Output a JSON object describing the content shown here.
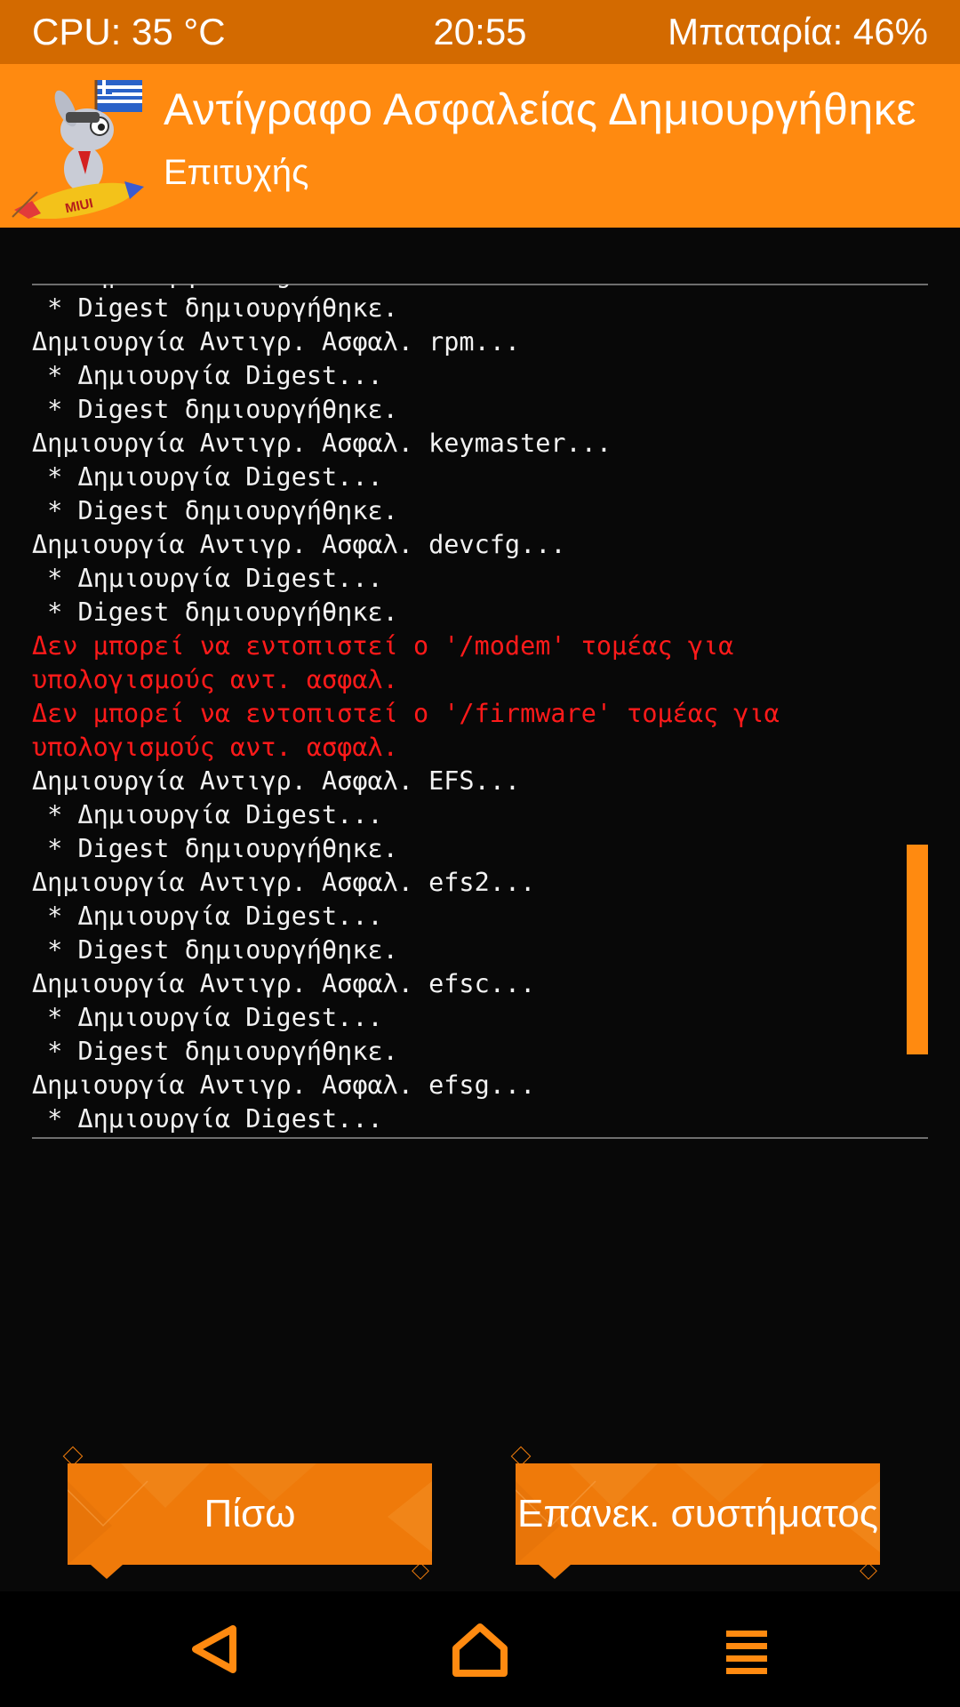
{
  "status_bar": {
    "cpu": "CPU: 35 °C",
    "time": "20:55",
    "battery": "Μπαταρία: 46%"
  },
  "header": {
    "title": "Αντίγραφο Ασφαλείας Δημιουργήθηκε",
    "subtitle": "Επιτυχής",
    "logo_text": "MIUI"
  },
  "console": {
    "lines": [
      {
        "text": " * Δημιουργία Digest...",
        "type": "normal"
      },
      {
        "text": " * Digest δημιουργήθηκε.",
        "type": "normal"
      },
      {
        "text": "Δημιουργία Αντιγρ. Ασφαλ. rpm...",
        "type": "normal"
      },
      {
        "text": " * Δημιουργία Digest...",
        "type": "normal"
      },
      {
        "text": " * Digest δημιουργήθηκε.",
        "type": "normal"
      },
      {
        "text": "Δημιουργία Αντιγρ. Ασφαλ. keymaster...",
        "type": "normal"
      },
      {
        "text": " * Δημιουργία Digest...",
        "type": "normal"
      },
      {
        "text": " * Digest δημιουργήθηκε.",
        "type": "normal"
      },
      {
        "text": "Δημιουργία Αντιγρ. Ασφαλ. devcfg...",
        "type": "normal"
      },
      {
        "text": " * Δημιουργία Digest...",
        "type": "normal"
      },
      {
        "text": " * Digest δημιουργήθηκε.",
        "type": "normal"
      },
      {
        "text": "Δεν μπορεί να εντοπιστεί ο '/modem' τομέας για",
        "type": "error"
      },
      {
        "text": "υπολογισμούς αντ. ασφαλ.",
        "type": "error"
      },
      {
        "text": "Δεν μπορεί να εντοπιστεί ο '/firmware' τομέας για",
        "type": "error"
      },
      {
        "text": "υπολογισμούς αντ. ασφαλ.",
        "type": "error"
      },
      {
        "text": "Δημιουργία Αντιγρ. Ασφαλ. EFS...",
        "type": "normal"
      },
      {
        "text": " * Δημιουργία Digest...",
        "type": "normal"
      },
      {
        "text": " * Digest δημιουργήθηκε.",
        "type": "normal"
      },
      {
        "text": "Δημιουργία Αντιγρ. Ασφαλ. efs2...",
        "type": "normal"
      },
      {
        "text": " * Δημιουργία Digest...",
        "type": "normal"
      },
      {
        "text": " * Digest δημιουργήθηκε.",
        "type": "normal"
      },
      {
        "text": "Δημιουργία Αντιγρ. Ασφαλ. efsc...",
        "type": "normal"
      },
      {
        "text": " * Δημιουργία Digest...",
        "type": "normal"
      },
      {
        "text": " * Digest δημιουργήθηκε.",
        "type": "normal"
      },
      {
        "text": "Δημιουργία Αντιγρ. Ασφαλ. efsg...",
        "type": "normal"
      },
      {
        "text": " * Δημιουργία Digest...",
        "type": "normal"
      }
    ]
  },
  "buttons": {
    "back_label": "Πίσω",
    "reboot_label": "Επανεκ. συστήματος"
  },
  "navbar": {
    "back_icon": "back-triangle-icon",
    "home_icon": "home-icon",
    "menu_icon": "menu-icon"
  },
  "colors": {
    "status_bar_bg": "#d36a00",
    "accent": "#ff8a10",
    "button_bg": "#ef7a0a",
    "error_text": "#ff1a1a",
    "console_text": "#f2f2f2",
    "background": "#080808"
  }
}
